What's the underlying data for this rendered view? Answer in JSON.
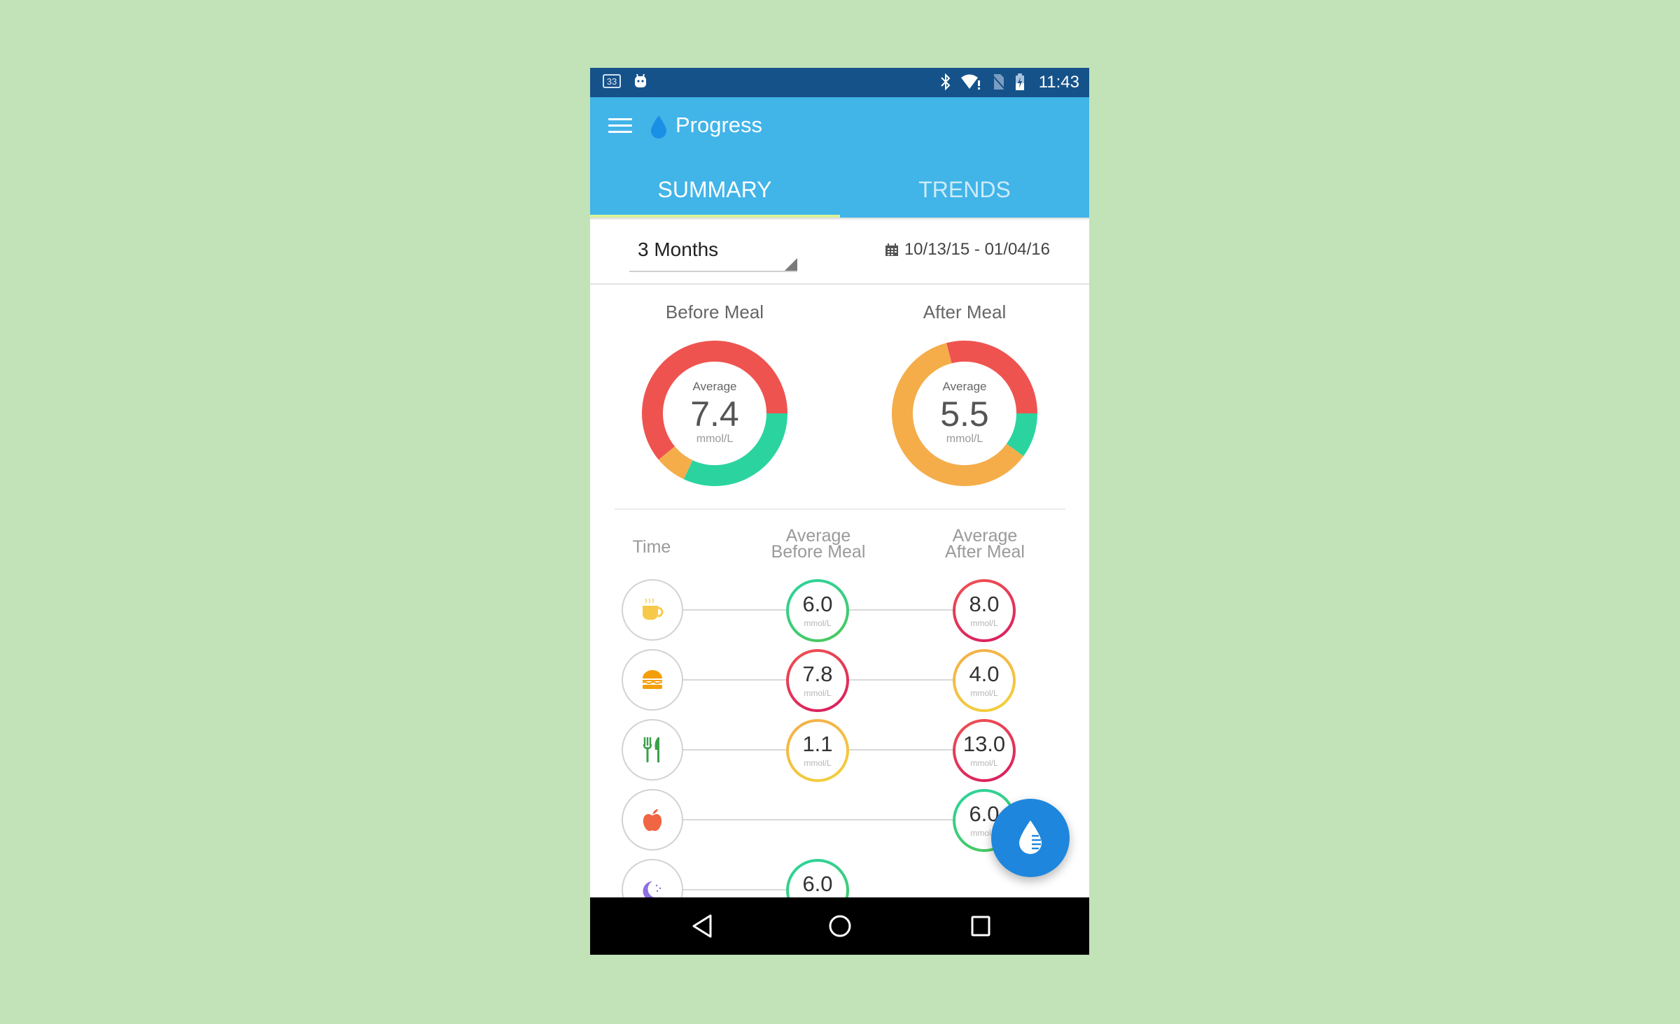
{
  "status_bar": {
    "notification_badge": "33",
    "time": "11:43",
    "icons": [
      "notification-count-icon",
      "android-icon",
      "bluetooth-icon",
      "wifi-alert-icon",
      "no-sim-icon",
      "battery-charging-icon"
    ]
  },
  "app_bar": {
    "title": "Progress",
    "menu_icon": "hamburger-menu-icon",
    "logo_icon": "water-drop-icon"
  },
  "tabs": [
    {
      "label": "SUMMARY",
      "active": true
    },
    {
      "label": "TRENDS",
      "active": false
    }
  ],
  "filter": {
    "period_selected": "3 Months",
    "date_range": "10/13/15 - 01/04/16",
    "date_icon": "calendar-icon"
  },
  "colors": {
    "status_bar": "#16528a",
    "app_bar": "#41b4e8",
    "tab_indicator": "#d9f29a",
    "high": "#ef5350",
    "normal": "#2bd49f",
    "low": "#f5ad4a",
    "fab": "#1e86dd",
    "background": "#c2e2b7"
  },
  "summary": {
    "before_meal": {
      "title": "Before Meal",
      "average_label": "Average",
      "average_value": "7.4",
      "unit": "mmol/L",
      "distribution_percent": {
        "high": 61,
        "normal": 32,
        "low": 7
      }
    },
    "after_meal": {
      "title": "After Meal",
      "average_label": "Average",
      "average_value": "5.5",
      "unit": "mmol/L",
      "distribution_percent": {
        "high": 29,
        "normal": 10,
        "low": 61
      }
    }
  },
  "table": {
    "headers": {
      "time": "Time",
      "before_line1": "Average",
      "before_line2": "Before Meal",
      "after_line1": "Average",
      "after_line2": "After Meal"
    },
    "rows": [
      {
        "time_icon": "coffee-cup-icon",
        "meal": "Breakfast",
        "before": "6.0",
        "before_status": "normal",
        "after": "8.0",
        "after_status": "high",
        "unit": "mmol/L"
      },
      {
        "time_icon": "burger-icon",
        "meal": "Lunch",
        "before": "7.8",
        "before_status": "high",
        "after": "4.0",
        "after_status": "low",
        "unit": "mmol/L"
      },
      {
        "time_icon": "fork-knife-icon",
        "meal": "Dinner",
        "before": "1.1",
        "before_status": "low",
        "after": "13.0",
        "after_status": "high",
        "unit": "mmol/L"
      },
      {
        "time_icon": "apple-icon",
        "meal": "Snack",
        "before": null,
        "before_status": null,
        "after": "6.0",
        "after_status": "normal",
        "unit": "mmol/L"
      },
      {
        "time_icon": "moon-icon",
        "meal": "Bedtime",
        "before": "6.0",
        "before_status": "normal",
        "after": null,
        "after_status": null,
        "unit": "mmol/L"
      }
    ]
  },
  "fab": {
    "icon": "add-blood-glucose-drop-icon"
  },
  "nav_bar": {
    "buttons": [
      "back-icon",
      "home-icon",
      "recents-icon"
    ]
  }
}
